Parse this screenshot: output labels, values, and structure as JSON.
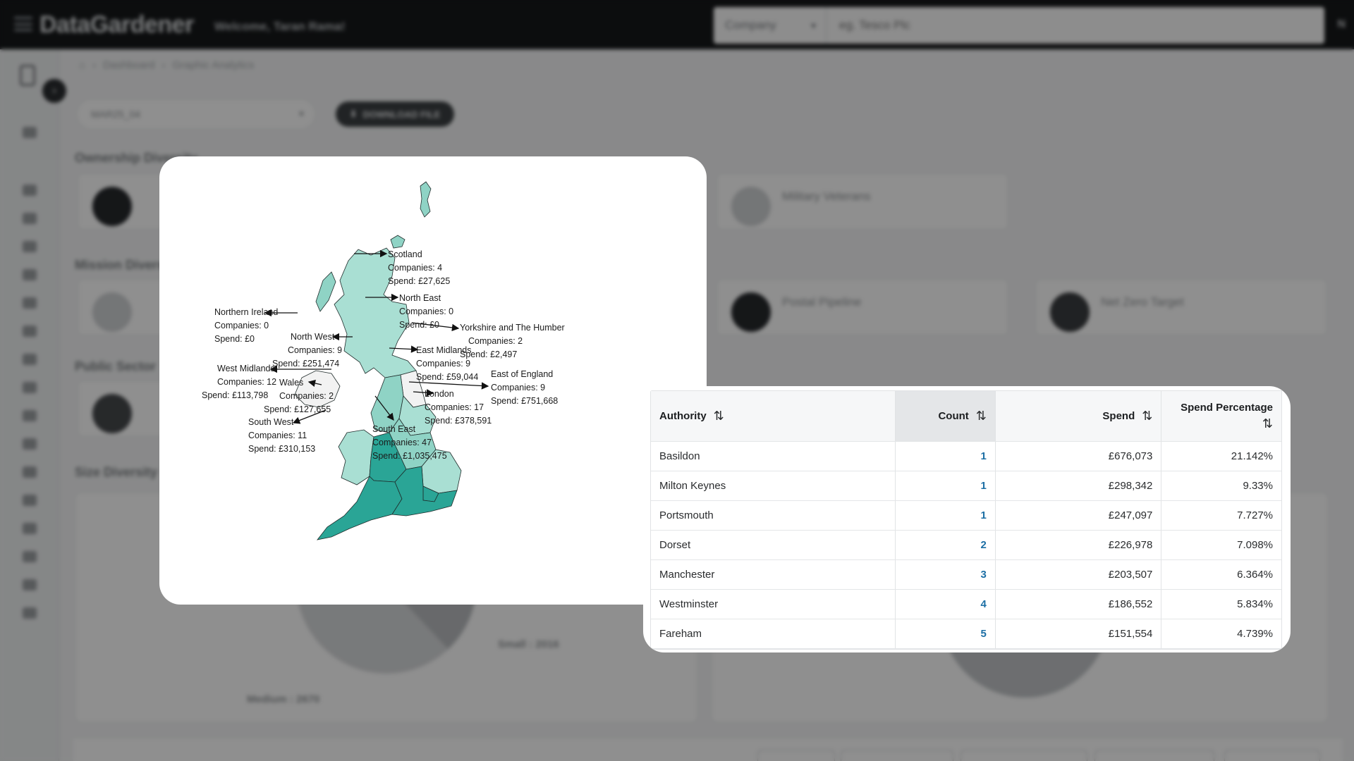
{
  "app": {
    "brand": "DataGardener",
    "welcome": "Welcome, Taran Rama!",
    "search_type": "Company",
    "search_placeholder": "eg. Tesco Plc",
    "user_initial": "N"
  },
  "breadcrumb": [
    "Dashboard",
    "Graphic Analytics"
  ],
  "file_select": "MAR25_04",
  "download_label": "DOWNLOAD FILE",
  "background_sections": {
    "ownership": "Ownership Diversity",
    "mission": "Mission Diversity",
    "public_sector": "Public Sector",
    "size": "Size Diversity",
    "military": "Military Veterans",
    "postal": "Postal Pipeline",
    "net_zero": "Net Zero Target",
    "pie_small": "Small : 2016",
    "pie_medium": "Medium : 2670"
  },
  "colors": {
    "teal_dark": "#2aa596",
    "teal_mid": "#8fd3c5",
    "teal_light": "#a9dfd3",
    "empty": "#f2f2f2",
    "link": "#1d6fa5"
  },
  "map_regions": [
    {
      "name": "Scotland",
      "companies": "Companies: 4",
      "spend": "Spend: £27,625"
    },
    {
      "name": "North East",
      "companies": "Companies: 0",
      "spend": "Spend: £0"
    },
    {
      "name": "Northern Ireland",
      "companies": "Companies: 0",
      "spend": "Spend: £0"
    },
    {
      "name": "Yorkshire and The Humber",
      "companies": "Companies: 2",
      "spend": "Spend: £2,497"
    },
    {
      "name": "North West",
      "companies": "Companies: 9",
      "spend": "Spend: £251,474"
    },
    {
      "name": "East Midlands",
      "companies": "Companies: 9",
      "spend": "Spend: £59,044"
    },
    {
      "name": "West Midlands",
      "companies": "Companies: 12",
      "spend": "Spend: £113,798"
    },
    {
      "name": "Wales",
      "companies": "Companies: 2",
      "spend": "Spend: £127,655"
    },
    {
      "name": "East of England",
      "companies": "Companies: 9",
      "spend": "Spend: £751,668"
    },
    {
      "name": "London",
      "companies": "Companies: 17",
      "spend": "Spend: £378,591"
    },
    {
      "name": "South West",
      "companies": "Companies: 11",
      "spend": "Spend: £310,153"
    },
    {
      "name": "South East",
      "companies": "Companies: 47",
      "spend": "Spend: £1,035,475"
    }
  ],
  "table": {
    "headers": {
      "authority": "Authority",
      "count": "Count",
      "spend": "Spend",
      "spend_pct": "Spend Percentage"
    },
    "rows": [
      {
        "authority": "Basildon",
        "count": "1",
        "spend": "£676,073",
        "pct": "21.142%"
      },
      {
        "authority": "Milton Keynes",
        "count": "1",
        "spend": "£298,342",
        "pct": "9.33%"
      },
      {
        "authority": "Portsmouth",
        "count": "1",
        "spend": "£247,097",
        "pct": "7.727%"
      },
      {
        "authority": "Dorset",
        "count": "2",
        "spend": "£226,978",
        "pct": "7.098%"
      },
      {
        "authority": "Manchester",
        "count": "3",
        "spend": "£203,507",
        "pct": "6.364%"
      },
      {
        "authority": "Westminster",
        "count": "4",
        "spend": "£186,552",
        "pct": "5.834%"
      },
      {
        "authority": "Fareham",
        "count": "5",
        "spend": "£151,554",
        "pct": "4.739%"
      }
    ]
  }
}
